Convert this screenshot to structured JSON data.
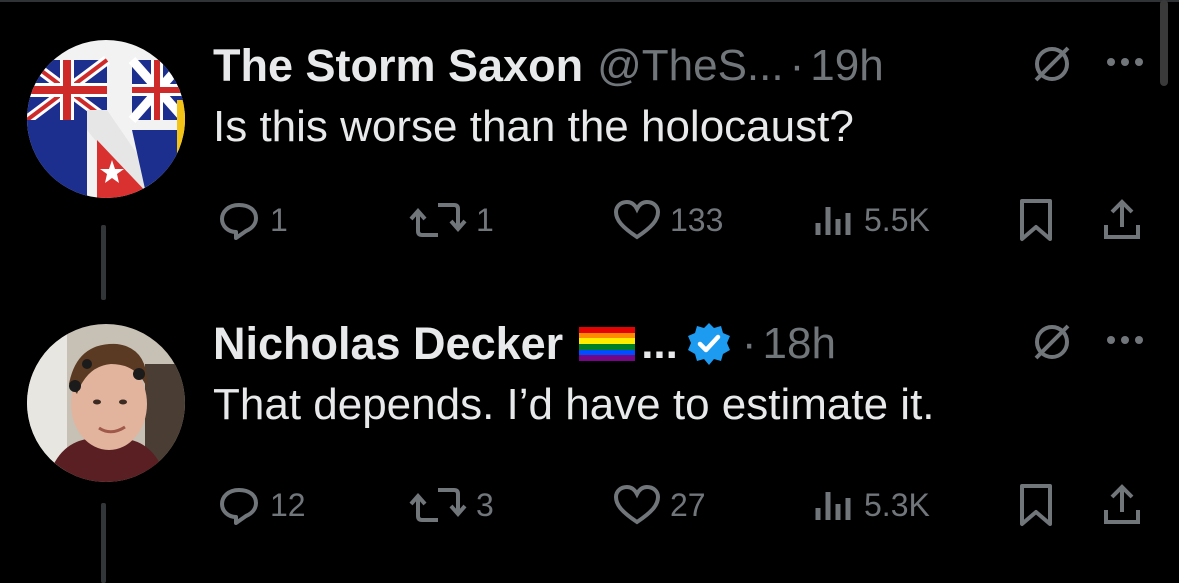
{
  "tweets": [
    {
      "author_name": "The Storm Saxon",
      "handle": "@TheS...",
      "dot": "·",
      "time": "19h",
      "text": "Is this worse than the holocaust?",
      "avatar": "flag-collage-avatar",
      "stats": {
        "replies": "1",
        "reposts": "1",
        "likes": "133",
        "views": "5.5K"
      }
    },
    {
      "author_name": "Nicholas Decker",
      "name_ellipsis": "...",
      "verified": true,
      "dot": "·",
      "time": "18h",
      "text": "That depends. I’d have to estimate it.",
      "avatar": "person-photo-avatar",
      "stats": {
        "replies": "12",
        "reposts": "3",
        "likes": "27",
        "views": "5.3K"
      }
    }
  ],
  "colors": {
    "background": "#000000",
    "primary_text": "#e7e9ea",
    "secondary_text": "#71767b",
    "verified": "#1d9bf0"
  }
}
